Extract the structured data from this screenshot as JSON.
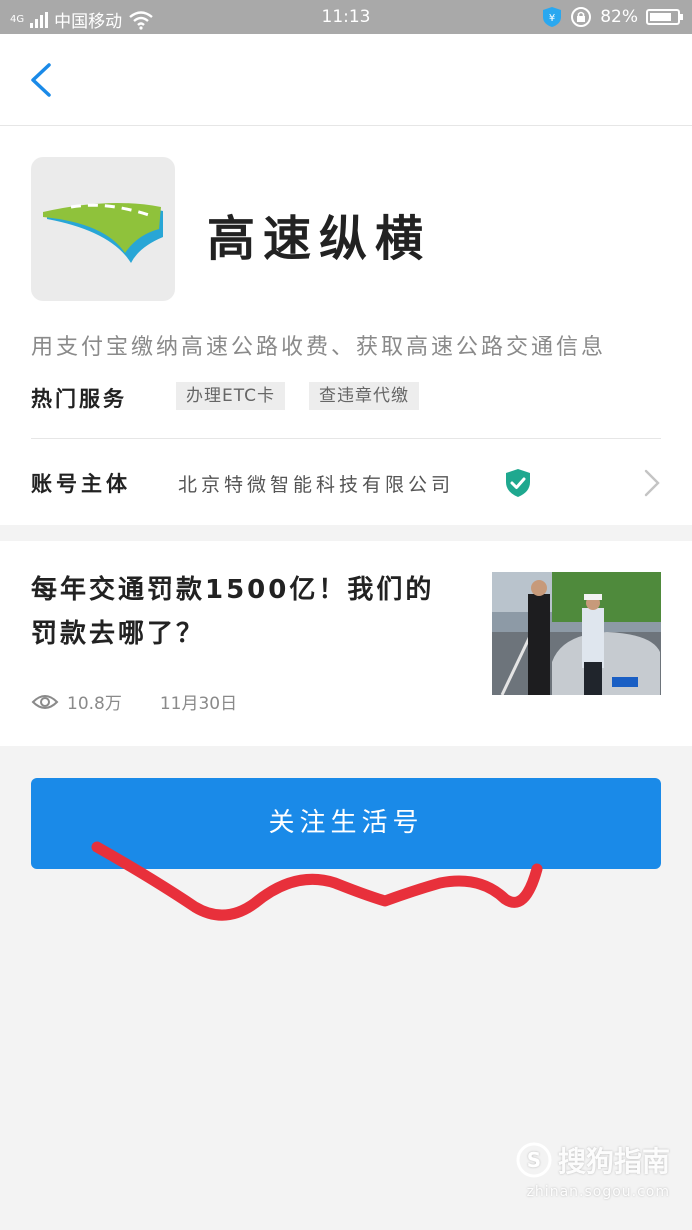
{
  "status_bar": {
    "network": "4G",
    "carrier": "中国移动",
    "time": "11:13",
    "battery_percent": "82%",
    "battery_level": 0.82
  },
  "nav": {
    "back_icon": "chevron-left-icon"
  },
  "profile": {
    "app_name": "高速纵横",
    "description": "用支付宝缴纳高速公路收费、获取高速公路交通信息",
    "hot_services_label": "热门服务",
    "services": [
      "办理ETC卡",
      "查违章代缴"
    ],
    "account_label": "账号主体",
    "account_name": "北京特微智能科技有限公司"
  },
  "article": {
    "title": "每年交通罚款1500亿！我们的罚款去哪了？",
    "views": "10.8万",
    "date": "11月30日"
  },
  "follow_button": "关注生活号",
  "watermark": {
    "brand": "搜狗指南",
    "url": "zhinan.sogou.com"
  },
  "colors": {
    "accent": "#1a8ae8",
    "verified": "#1fa88f",
    "scribble": "#e8303b"
  }
}
